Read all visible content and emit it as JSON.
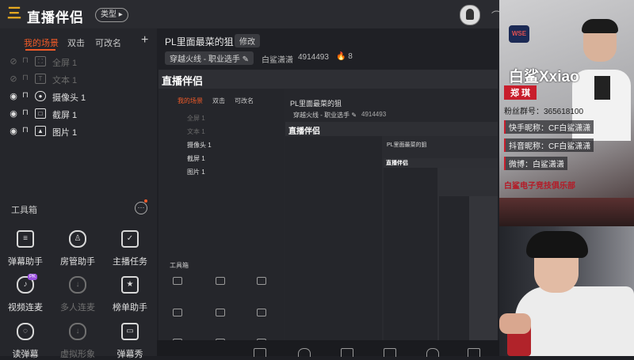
{
  "app": {
    "logo_mark": "三国",
    "logo_text": "直播伴侣",
    "type_button": "类型 ▸"
  },
  "colors": {
    "accent": "#f05a28",
    "background": "#1e1f24",
    "panel": "#25262b",
    "pk_badge": "#9b50e0",
    "club_red": "#c81e2c"
  },
  "scenes": {
    "tabs": [
      {
        "label": "我的场景",
        "active": true
      },
      {
        "label": "双击",
        "active": false
      },
      {
        "label": "可改名",
        "active": false
      }
    ],
    "add_icon": "+"
  },
  "sources": [
    {
      "label": "全屏 1",
      "visible": false,
      "icon": "fullscreen-icon"
    },
    {
      "label": "文本 1",
      "visible": false,
      "icon": "text-icon"
    },
    {
      "label": "摄像头 1",
      "visible": true,
      "icon": "camera-icon"
    },
    {
      "label": "截屏 1",
      "visible": true,
      "icon": "crop-icon"
    },
    {
      "label": "图片 1",
      "visible": true,
      "icon": "image-icon"
    }
  ],
  "toolbox": {
    "title": "工具箱",
    "more": "···",
    "tools": [
      {
        "label": "弹幕助手",
        "icon": "danmaku-icon",
        "disabled": false,
        "badge": ""
      },
      {
        "label": "房管助手",
        "icon": "user-admin-icon",
        "disabled": false,
        "badge": ""
      },
      {
        "label": "主播任务",
        "icon": "task-icon",
        "disabled": false,
        "badge": ""
      },
      {
        "label": "视频连麦",
        "icon": "mic-link-icon",
        "disabled": false,
        "badge": "PK"
      },
      {
        "label": "多人连麦",
        "icon": "download-icon",
        "disabled": true,
        "badge": ""
      },
      {
        "label": "榜单助手",
        "icon": "ranking-icon",
        "disabled": false,
        "badge": ""
      },
      {
        "label": "读弹幕",
        "icon": "read-danmaku-icon",
        "disabled": false,
        "badge": ""
      },
      {
        "label": "虚拟形象",
        "icon": "avatar-virtual-icon",
        "disabled": true,
        "badge": ""
      },
      {
        "label": "弹幕秀",
        "icon": "danmaku-show-icon",
        "disabled": false,
        "badge": ""
      }
    ]
  },
  "room": {
    "title": "PL里面最菜的狙",
    "edit_label": "修改",
    "category": "穿越火线 - 职业选手 ✎",
    "host": "白鲨潇潇",
    "room_id": "4914493",
    "hot_icon": "flame-icon",
    "hot_count": "8"
  },
  "overlay": {
    "name": "白鲨Xxiao",
    "real_name": "郑 琪",
    "fans_group": "粉丝群号：365618100",
    "kuaishou": "快手昵称：CF白鲨潇潇",
    "douyin": "抖音昵称：CF白鲨潇潇",
    "weibo": "微博：白鲨潇潇",
    "club": "白鲨电子竞技俱乐部",
    "team_logo": "WSE"
  }
}
